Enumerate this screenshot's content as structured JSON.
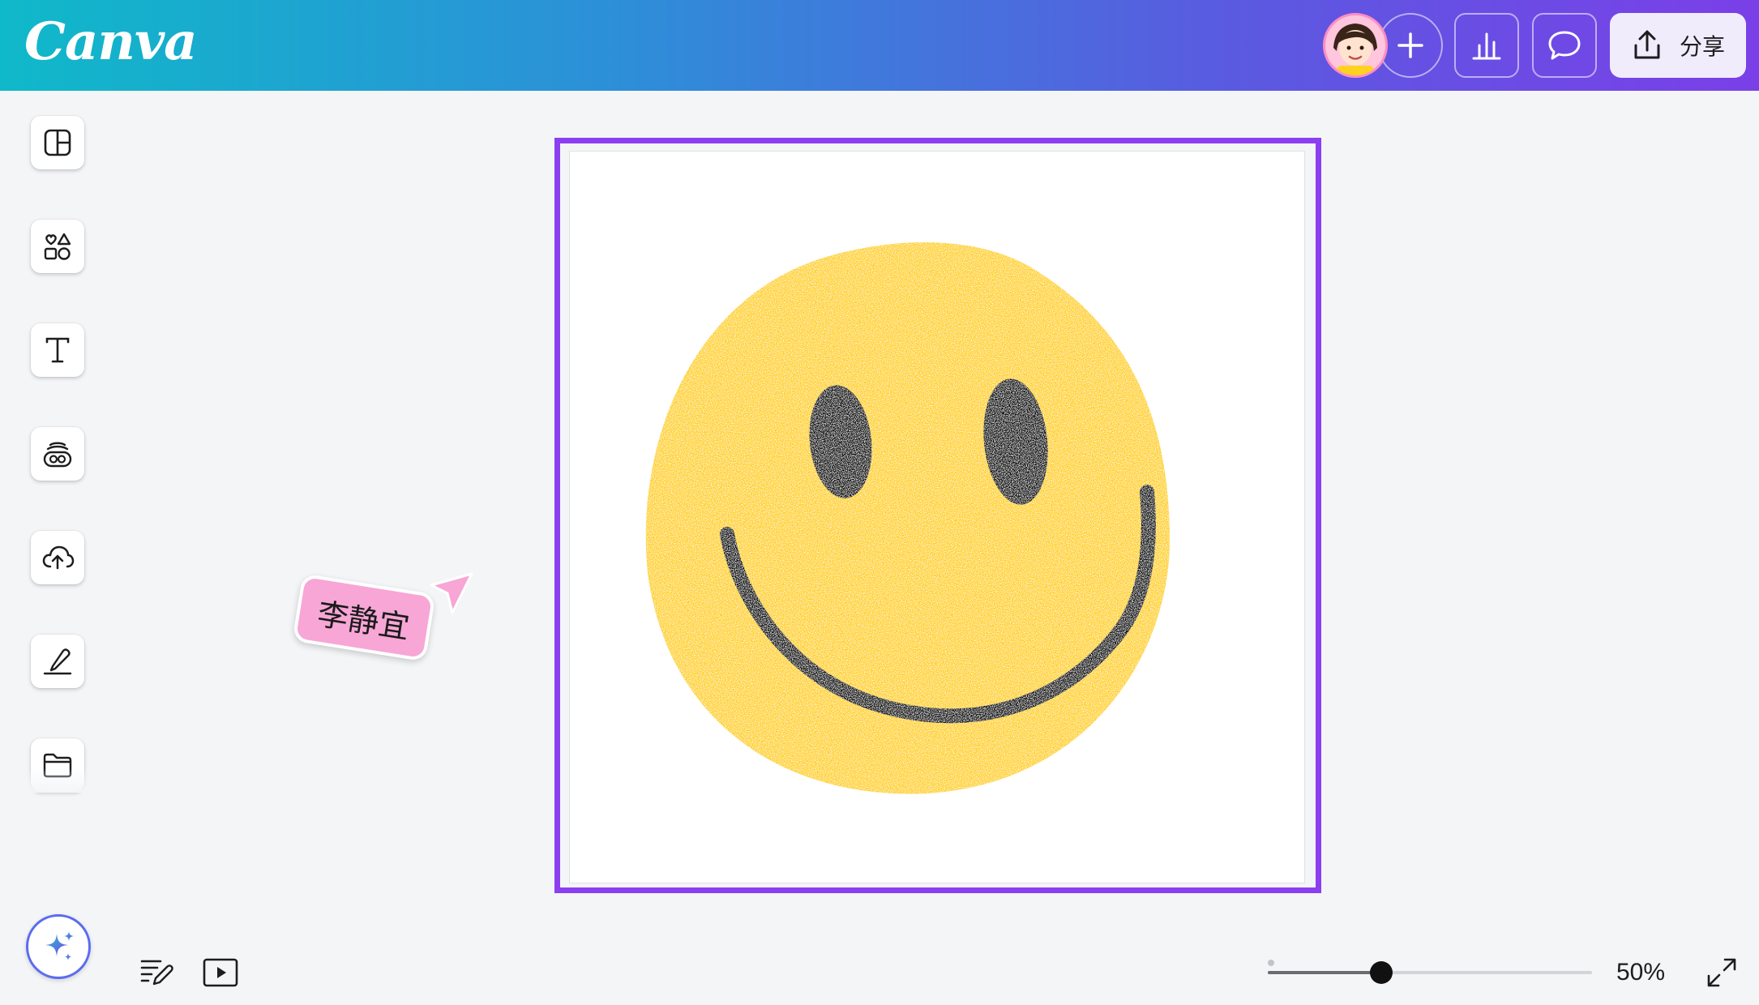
{
  "app": {
    "logo": "Canva"
  },
  "header": {
    "avatar_icon": "user-avatar",
    "add_icon": "plus-icon",
    "insights_icon": "bar-chart-icon",
    "comments_icon": "comment-icon",
    "share_label": "分享",
    "share_icon": "upload-icon",
    "gradient_colors": [
      "#0fb9c9",
      "#2d8fd8",
      "#5a5ae0",
      "#7b3fe8"
    ]
  },
  "sidebar": {
    "items": [
      {
        "icon": "design-layout-icon"
      },
      {
        "icon": "elements-icon"
      },
      {
        "icon": "text-icon"
      },
      {
        "icon": "brand-icon"
      },
      {
        "icon": "cloud-upload-icon"
      },
      {
        "icon": "draw-icon"
      },
      {
        "icon": "folder-icon"
      }
    ]
  },
  "canvas": {
    "selection_color": "#8b3ff0",
    "content": "smiley-face-drawing",
    "face_color": "#ffd21f",
    "feature_color": "#111111"
  },
  "collaborator": {
    "name": "李静宜",
    "color": "#f7a6d6"
  },
  "footer": {
    "magic_icon": "sparkle-icon",
    "notes_icon": "notes-icon",
    "present_icon": "play-icon",
    "zoom_label": "50%",
    "zoom_level": 0.35,
    "fullscreen_icon": "expand-icon"
  }
}
